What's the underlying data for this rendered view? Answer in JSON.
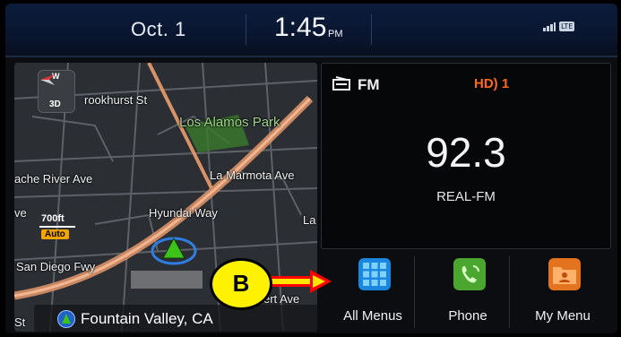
{
  "status_bar": {
    "date": "Oct. 1",
    "time": "1:45",
    "ampm": "PM",
    "network": "LTE"
  },
  "map": {
    "compass_heading": "W",
    "compass_mode": "3D",
    "street_labels": [
      "rookhurst St",
      "Los Alamos Park",
      "La Marmota Ave",
      "ache River Ave",
      "Hyundai Way",
      "San Diego Fwy",
      "ert Ave",
      "ve",
      "La",
      "St"
    ],
    "scale": {
      "distance": "700ft",
      "mode": "Auto"
    },
    "location": "Fountain Valley, CA"
  },
  "radio": {
    "band": "FM",
    "hd_channel": "1",
    "frequency": "92.3",
    "station": "REAL-FM"
  },
  "buttons": [
    {
      "label": "All Menus",
      "icon": "grid-icon"
    },
    {
      "label": "Phone",
      "icon": "phone-icon"
    },
    {
      "label": "My Menu",
      "icon": "folder-user-icon"
    }
  ],
  "annotation": {
    "letter": "B"
  },
  "colors": {
    "status_bar": "#0a1630",
    "hd": "#ff6a1a",
    "callout": "#fff200",
    "arrow": "#ff0000",
    "all_menus_icon": "#2aa7ff",
    "phone_icon": "#5bbf36",
    "my_menu_icon": "#f0822a"
  }
}
